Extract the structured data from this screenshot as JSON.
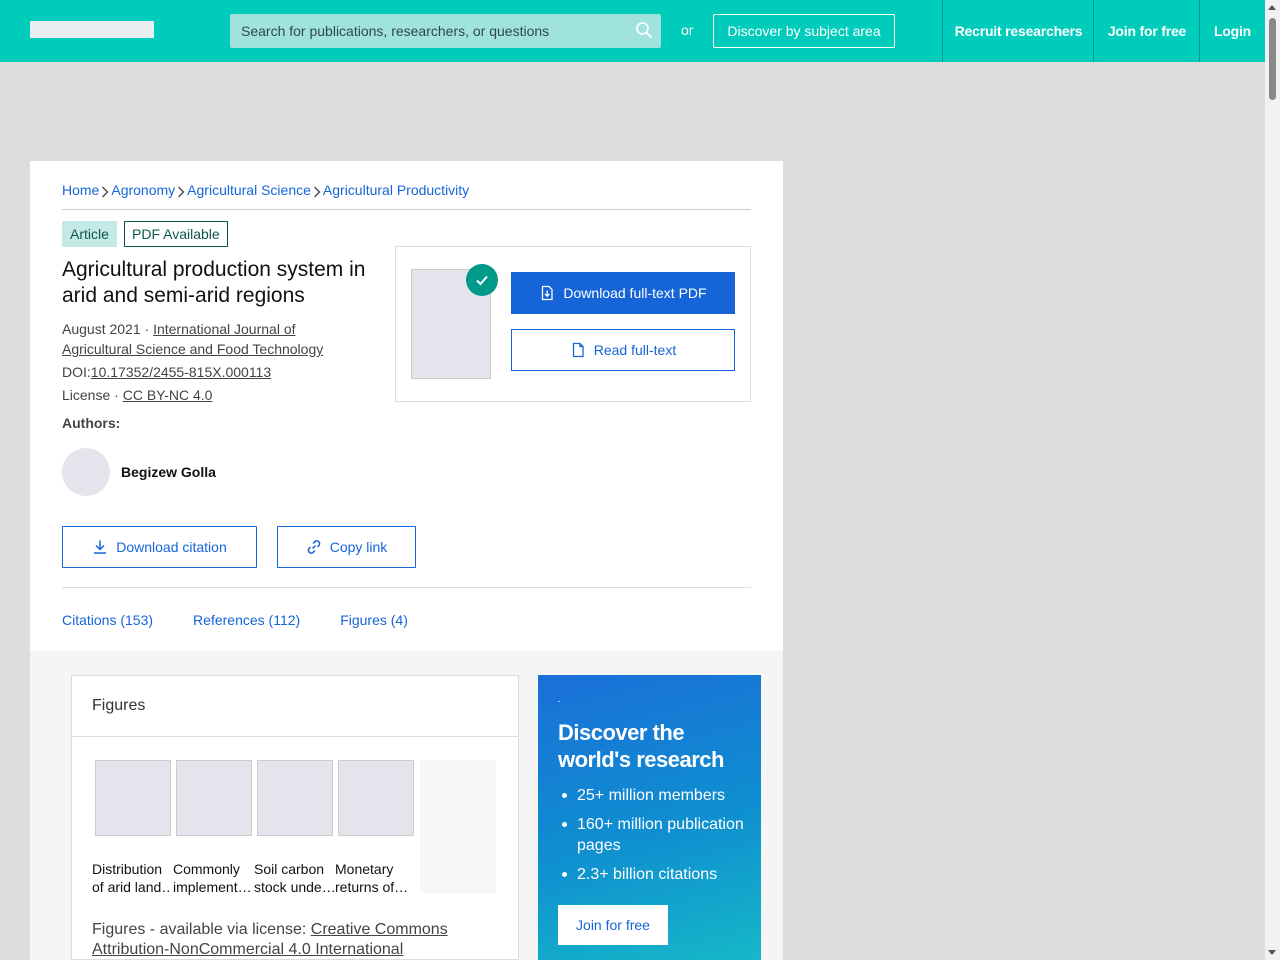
{
  "header": {
    "search_placeholder": "Search for publications, researchers, or questions",
    "or_text": "or",
    "discover_label": "Discover by subject area",
    "recruit_label": "Recruit researchers",
    "join_label": "Join for free",
    "login_label": "Login"
  },
  "breadcrumb": [
    "Home",
    "Agronomy",
    "Agricultural Science",
    "Agricultural Productivity"
  ],
  "tags": {
    "article": "Article",
    "pdf": "PDF Available"
  },
  "publication": {
    "title": "Agricultural production system in arid and semi-arid regions",
    "date": "August 2021",
    "date_sep": " · ",
    "journal": "International Journal of Agricultural Science and Food Technology",
    "doi_label": "DOI:",
    "doi": "10.17352/2455-815X.000113",
    "license_label": "License · ",
    "license": "CC BY-NC 4.0",
    "authors_label": "Authors:",
    "author": "Begizew Golla"
  },
  "actions": {
    "download_citation": "Download citation",
    "copy_link": "Copy link",
    "download_pdf": "Download full-text PDF",
    "read_fulltext": "Read full-text"
  },
  "tabs": [
    "Citations (153)",
    "References (112)",
    "Figures (4)"
  ],
  "figures": {
    "title": "Figures",
    "items": [
      {
        "caption1": "Distribution",
        "caption2": "of arid land…"
      },
      {
        "caption1": "Commonly",
        "caption2": "implement…"
      },
      {
        "caption1": "Soil carbon",
        "caption2": "stock unde…"
      },
      {
        "caption1": "Monetary",
        "caption2": "returns of…"
      }
    ],
    "license_text": "Figures - available via license: ",
    "license_link": "Creative Commons Attribution-NonCommercial 4.0 International"
  },
  "promo": {
    "title": "Discover the world's research",
    "bullets": [
      "25+ million members",
      "160+ million publication pages",
      "2.3+ billion citations"
    ],
    "join_label": "Join for free"
  },
  "colors": {
    "header": "#00ccbb",
    "link": "#1565d8",
    "badge": "#00998a"
  },
  "icons": [
    "search-icon",
    "chevron-right-icon",
    "check-icon",
    "pdf-download-icon",
    "document-icon",
    "download-icon",
    "link-icon"
  ]
}
